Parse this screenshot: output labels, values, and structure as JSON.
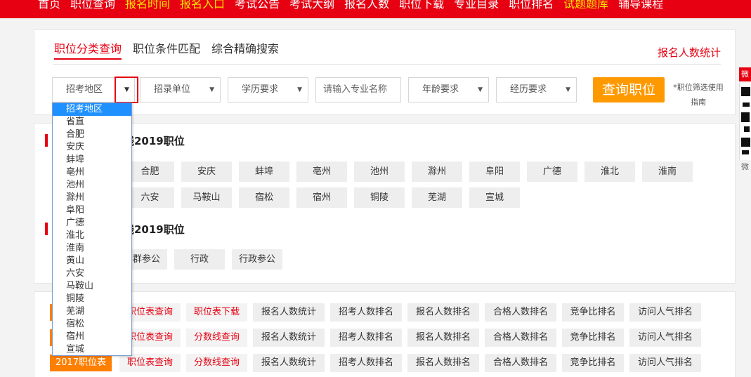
{
  "topnav": {
    "items": [
      {
        "label": "首页",
        "highlight": false
      },
      {
        "label": "职位查询",
        "highlight": false
      },
      {
        "label": "报名时间",
        "highlight": true
      },
      {
        "label": "报名入口",
        "highlight": true
      },
      {
        "label": "考试公告",
        "highlight": false
      },
      {
        "label": "考试大纲",
        "highlight": false
      },
      {
        "label": "报名人数",
        "highlight": false
      },
      {
        "label": "职位下载",
        "highlight": false
      },
      {
        "label": "专业目录",
        "highlight": false
      },
      {
        "label": "职位排名",
        "highlight": false
      },
      {
        "label": "试题题库",
        "highlight": true
      },
      {
        "label": "辅导课程",
        "highlight": false
      }
    ]
  },
  "tabs": [
    {
      "label": "职位分类查询",
      "active": true
    },
    {
      "label": "职位条件匹配",
      "active": false
    },
    {
      "label": "综合精确搜索",
      "active": false
    }
  ],
  "stat_link": "报名人数统计",
  "filters": {
    "region": "招考地区",
    "unit": "招录单位",
    "education": "学历要求",
    "major_placeholder": "请输入专业名称",
    "age": "年龄要求",
    "experience": "经历要求"
  },
  "query_button": "查询职位",
  "guide_text": "*职位筛选使用指南",
  "section1": {
    "title_suffix": "线2019职位",
    "tags_row1": [
      "合肥",
      "安庆",
      "蚌埠",
      "亳州",
      "池州",
      "滁州",
      "阜阳",
      "广德",
      "淮北",
      "淮南"
    ],
    "tags_row2": [
      "六安",
      "马鞍山",
      "宿松",
      "宿州",
      "铜陵",
      "芜湖",
      "宣城"
    ]
  },
  "section2": {
    "title_suffix": "线2019职位",
    "tags": [
      "群参公",
      "行政",
      "行政参公"
    ]
  },
  "rows": [
    {
      "label": "",
      "links": [
        "职位表查询",
        "职位表下载",
        "报名人数统计",
        "招考人数排名",
        "报名人数排名",
        "合格人数排名",
        "竞争比排名",
        "访问人气排名"
      ]
    },
    {
      "label": "",
      "links": [
        "职位表查询",
        "分数线查询",
        "报名人数统计",
        "招考人数排名",
        "报名人数排名",
        "合格人数排名",
        "竞争比排名",
        "访问人气排名"
      ]
    },
    {
      "label": "2017职位表",
      "links": [
        "职位表查询",
        "分数线查询",
        "报名人数统计",
        "招考人数排名",
        "报名人数排名",
        "合格人数排名",
        "竞争比排名",
        "访问人气排名"
      ]
    }
  ],
  "dropdown": {
    "options": [
      "招考地区",
      "省直",
      "合肥",
      "安庆",
      "蚌埠",
      "亳州",
      "池州",
      "滁州",
      "阜阳",
      "广德",
      "淮北",
      "淮南",
      "黄山",
      "六安",
      "马鞍山",
      "铜陵",
      "芜湖",
      "宿松",
      "宿州",
      "宣城"
    ],
    "selected_index": 0
  },
  "side": {
    "badge": "微",
    "caption": "微"
  },
  "colors": {
    "brand_red": "#e60012",
    "nav_highlight": "#ffe400",
    "orange": "#ff9900",
    "select_blue": "#1e90ff"
  }
}
